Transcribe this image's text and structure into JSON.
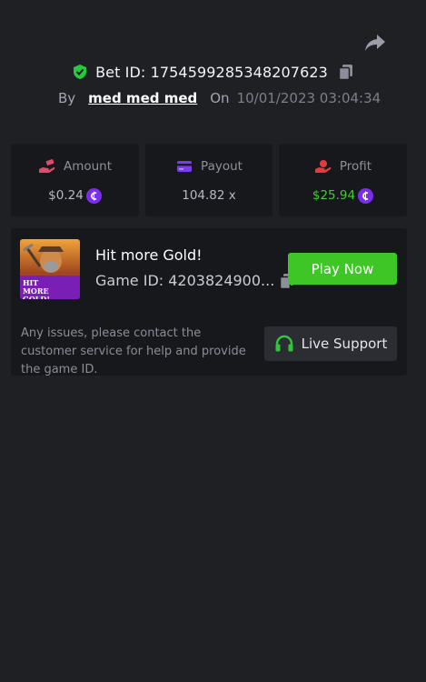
{
  "header": {
    "bet_id_label": "Bet ID: 1754599285348207623",
    "by_label": "By",
    "username": "med med med",
    "on_label": "On",
    "date": "10/01/2023 03:04:34"
  },
  "stats": [
    {
      "label": "Amount",
      "value": "$0.24",
      "icon": "hand-coins-icon",
      "coin": true,
      "color": "#b6b9c3"
    },
    {
      "label": "Payout",
      "value": "104.82 x",
      "icon": "card-icon",
      "coin": false,
      "color": "#b6b9c3"
    },
    {
      "label": "Profit",
      "value": "$25.94",
      "icon": "profit-hand-icon",
      "coin": true,
      "color": "#3bd12a"
    }
  ],
  "game": {
    "title": "Hit more Gold!",
    "id_label": "Game ID: 4203824900...",
    "thumbnail_text": "HIT MORE GOLD!",
    "play_label": "Play Now"
  },
  "support": {
    "notice": "Any issues, please contact the customer service for help and provide the game ID.",
    "button_label": "Live Support"
  },
  "colors": {
    "background": "#1f2024",
    "card": "#17181c",
    "accent_green": "#3ec526",
    "coin_purple": "#7b2cf0",
    "shield_green": "#27c93f"
  }
}
